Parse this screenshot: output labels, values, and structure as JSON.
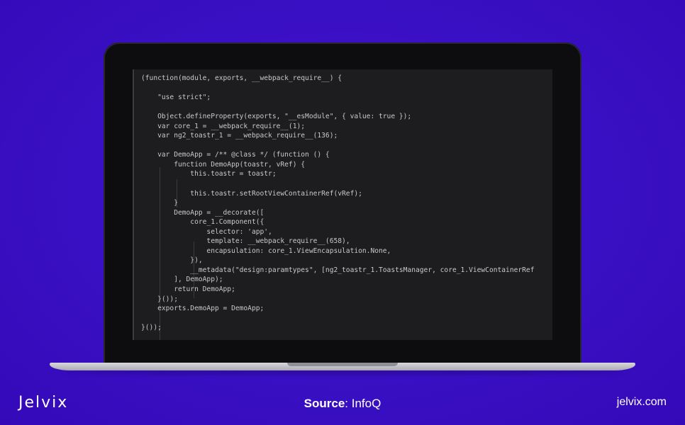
{
  "code_lines": [
    "(function(module, exports, __webpack_require__) {",
    "",
    "    \"use strict\";",
    "",
    "    Object.defineProperty(exports, \"__esModule\", { value: true });",
    "    var core_1 = __webpack_require__(1);",
    "    var ng2_toastr_1 = __webpack_require__(136);",
    "",
    "    var DemoApp = /** @class */ (function () {",
    "        function DemoApp(toastr, vRef) {",
    "            this.toastr = toastr;",
    "",
    "            this.toastr.setRootViewContainerRef(vRef);",
    "        }",
    "        DemoApp = __decorate([",
    "            core_1.Component({",
    "                selector: 'app',",
    "                template: __webpack_require__(658),",
    "                encapsulation: core_1.ViewEncapsulation.None,",
    "            }),",
    "            __metadata(\"design:paramtypes\", [ng2_toastr_1.ToastsManager, core_1.ViewContainerRef",
    "        ], DemoApp);",
    "        return DemoApp;",
    "    }());",
    "    exports.DemoApp = DemoApp;",
    "",
    "}());"
  ],
  "footer": {
    "logo": "Jelvix",
    "source_label": "Source",
    "source_value": ": InfoQ",
    "site": "jelvix.com"
  },
  "colors": {
    "background": "#3a10c4",
    "code_text": "#c9c9c9",
    "keyword": "#8f7fd6",
    "string": "#b7a6e8"
  }
}
